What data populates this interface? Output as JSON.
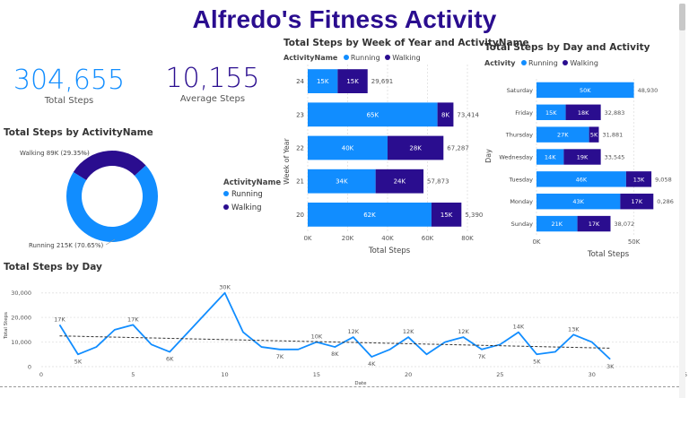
{
  "page": {
    "title": "Alfredo's Fitness Activity"
  },
  "kpis": {
    "total_steps": {
      "value": "304,655",
      "label": "Total Steps",
      "color": "#118dff"
    },
    "average_steps": {
      "value": "10,155",
      "label": "Average Steps",
      "color": "#2a0d8f"
    }
  },
  "colors": {
    "running": "#118dff",
    "walking": "#2a0d8f"
  },
  "donut": {
    "title": "Total Steps by ActivityName",
    "legend_title": "ActivityName",
    "walking_label": "Walking 89K (29.35%)",
    "running_label": "Running 215K (70.65%)",
    "legend_running": "Running",
    "legend_walking": "Walking"
  },
  "week_chart": {
    "title": "Total Steps by Week of Year and ActivityName",
    "legend_title": "ActivityName",
    "legend_running": "Running",
    "legend_walking": "Walking",
    "ylabel": "Week of Year",
    "xlabel": "Total Steps",
    "xticks": [
      "0K",
      "20K",
      "40K",
      "60K",
      "80K"
    ]
  },
  "day_chart": {
    "title": "Total Steps by Day and Activity",
    "legend_title": "Activity",
    "legend_running": "Running",
    "legend_walking": "Walking",
    "ylabel": "Day",
    "xlabel": "Total Steps",
    "xticks": [
      "0K",
      "50K"
    ]
  },
  "line_chart": {
    "title": "Total Steps by Day",
    "ylabel": "Total Steps",
    "xlabel": "Date",
    "yticks": [
      "0",
      "10,000",
      "20,000",
      "30,000"
    ],
    "xticks": [
      "0",
      "5",
      "10",
      "15",
      "20",
      "25",
      "30",
      "35"
    ]
  },
  "chart_data": [
    {
      "type": "pie",
      "title": "Total Steps by ActivityName",
      "categories": [
        "Running",
        "Walking"
      ],
      "values": [
        215000,
        89000
      ],
      "percents": [
        70.65,
        29.35
      ]
    },
    {
      "type": "bar",
      "title": "Total Steps by Week of Year and ActivityName",
      "orientation": "horizontal",
      "stacked": true,
      "categories": [
        "24",
        "23",
        "22",
        "21",
        "20"
      ],
      "series": [
        {
          "name": "Running",
          "values": [
            15000,
            65000,
            40000,
            34000,
            62000
          ],
          "labels": [
            "15K",
            "65K",
            "40K",
            "34K",
            "62K"
          ]
        },
        {
          "name": "Walking",
          "values": [
            15000,
            8000,
            28000,
            24000,
            15000
          ],
          "labels": [
            "15K",
            "8K",
            "28K",
            "24K",
            "15K"
          ]
        }
      ],
      "totals": [
        "29,691",
        "73,414",
        "67,287",
        "57,873",
        "5,390"
      ],
      "total_values": [
        29691,
        73414,
        67287,
        57873,
        77390
      ],
      "xlim": [
        0,
        80000
      ]
    },
    {
      "type": "bar",
      "title": "Total Steps by Day and Activity",
      "orientation": "horizontal",
      "stacked": true,
      "categories": [
        "Saturday",
        "Friday",
        "Thursday",
        "Wednesday",
        "Tuesday",
        "Monday",
        "Sunday"
      ],
      "series": [
        {
          "name": "Running",
          "values": [
            50000,
            15000,
            27000,
            14000,
            46000,
            43000,
            21000
          ],
          "labels": [
            "50K",
            "15K",
            "27K",
            "14K",
            "46K",
            "43K",
            "21K"
          ]
        },
        {
          "name": "Walking",
          "values": [
            0,
            18000,
            5000,
            19000,
            13000,
            17000,
            17000
          ],
          "labels": [
            "",
            "18K",
            "5K",
            "19K",
            "13K",
            "17K",
            "17K"
          ]
        }
      ],
      "totals": [
        "48,930",
        "32,883",
        "31,881",
        "33,545",
        "9,058",
        "0,286",
        "38,072"
      ],
      "total_values": [
        48930,
        32883,
        31881,
        33545,
        59058,
        60286,
        38072
      ],
      "xlim": [
        0,
        70000
      ]
    },
    {
      "type": "line",
      "title": "Total Steps by Day",
      "x": [
        1,
        2,
        3,
        4,
        5,
        6,
        7,
        8,
        9,
        10,
        11,
        12,
        13,
        14,
        15,
        16,
        17,
        18,
        19,
        20,
        21,
        22,
        23,
        24,
        25,
        26,
        27,
        28,
        29,
        30,
        31
      ],
      "values": [
        17000,
        5000,
        8000,
        15000,
        17000,
        9000,
        6000,
        14000,
        22000,
        30000,
        14000,
        8000,
        7000,
        7000,
        10000,
        8000,
        12000,
        4000,
        7000,
        12000,
        5000,
        10000,
        12000,
        7000,
        9000,
        14000,
        5000,
        6000,
        13000,
        10000,
        3000
      ],
      "point_labels": {
        "1": "17K",
        "2": "5K",
        "5": "17K",
        "7": "6K",
        "10": "30K",
        "13": "7K",
        "15": "10K",
        "16": "8K",
        "17": "12K",
        "18": "4K",
        "20": "12K",
        "23": "12K",
        "24": "7K",
        "26": "14K",
        "27": "5K",
        "29": "13K",
        "31": "3K"
      },
      "trend": [
        12500,
        7500
      ],
      "ylim": [
        0,
        35000
      ],
      "xlim": [
        0,
        35
      ]
    }
  ]
}
